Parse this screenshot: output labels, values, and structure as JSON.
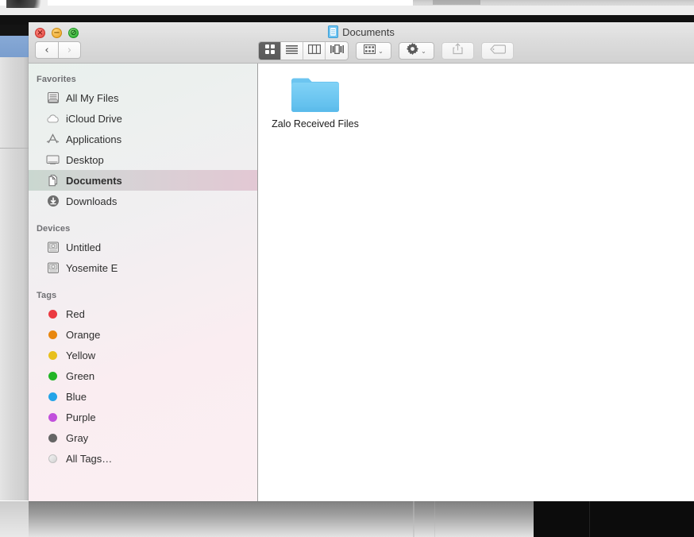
{
  "window": {
    "title": "Documents",
    "title_icon": "documents-folder-icon",
    "traffic_lights": {
      "close": "×",
      "minimize": "−",
      "zoom": "⊘"
    }
  },
  "toolbar": {
    "back_label": "‹",
    "forward_label": "›",
    "view_modes": [
      {
        "name": "icon-view",
        "icon": "grid-icon",
        "active": true
      },
      {
        "name": "list-view",
        "icon": "list-icon",
        "active": false
      },
      {
        "name": "column-view",
        "icon": "columns-icon",
        "active": false
      },
      {
        "name": "coverflow-view",
        "icon": "coverflow-icon",
        "active": false
      }
    ],
    "arrange_icon": "arrange-grid-icon",
    "action_icon": "gear-icon",
    "share_icon": "share-icon",
    "tag_icon": "tag-icon",
    "chevron": "⌄"
  },
  "sidebar": {
    "sections": [
      {
        "title": "Favorites",
        "items": [
          {
            "label": "All My Files",
            "icon": "all-my-files-icon",
            "selected": false
          },
          {
            "label": "iCloud Drive",
            "icon": "icloud-icon",
            "selected": false
          },
          {
            "label": "Applications",
            "icon": "applications-icon",
            "selected": false
          },
          {
            "label": "Desktop",
            "icon": "desktop-icon",
            "selected": false
          },
          {
            "label": "Documents",
            "icon": "documents-icon",
            "selected": true
          },
          {
            "label": "Downloads",
            "icon": "downloads-icon",
            "selected": false
          }
        ]
      },
      {
        "title": "Devices",
        "items": [
          {
            "label": "Untitled",
            "icon": "hard-drive-icon",
            "selected": false
          },
          {
            "label": "Yosemite E",
            "icon": "hard-drive-icon",
            "selected": false
          }
        ]
      },
      {
        "title": "Tags",
        "items": [
          {
            "label": "Red",
            "icon": "tag-dot-icon",
            "color": "#eb3941",
            "selected": false
          },
          {
            "label": "Orange",
            "icon": "tag-dot-icon",
            "color": "#e8870f",
            "selected": false
          },
          {
            "label": "Yellow",
            "icon": "tag-dot-icon",
            "color": "#e8c01c",
            "selected": false
          },
          {
            "label": "Green",
            "icon": "tag-dot-icon",
            "color": "#22b526",
            "selected": false
          },
          {
            "label": "Blue",
            "icon": "tag-dot-icon",
            "color": "#23a4e8",
            "selected": false
          },
          {
            "label": "Purple",
            "icon": "tag-dot-icon",
            "color": "#c150dc",
            "selected": false
          },
          {
            "label": "Gray",
            "icon": "tag-dot-icon",
            "color": "#656565",
            "selected": false
          },
          {
            "label": "All Tags…",
            "icon": "all-tags-icon",
            "color": "",
            "selected": false
          }
        ]
      }
    ]
  },
  "content": {
    "items": [
      {
        "label": "Zalo Received Files",
        "icon": "folder-icon",
        "type": "folder"
      }
    ]
  },
  "colors": {
    "folder_blue": "#62c0ef",
    "selection": "#d8cdd4",
    "title_text": "#3b3b3b"
  }
}
